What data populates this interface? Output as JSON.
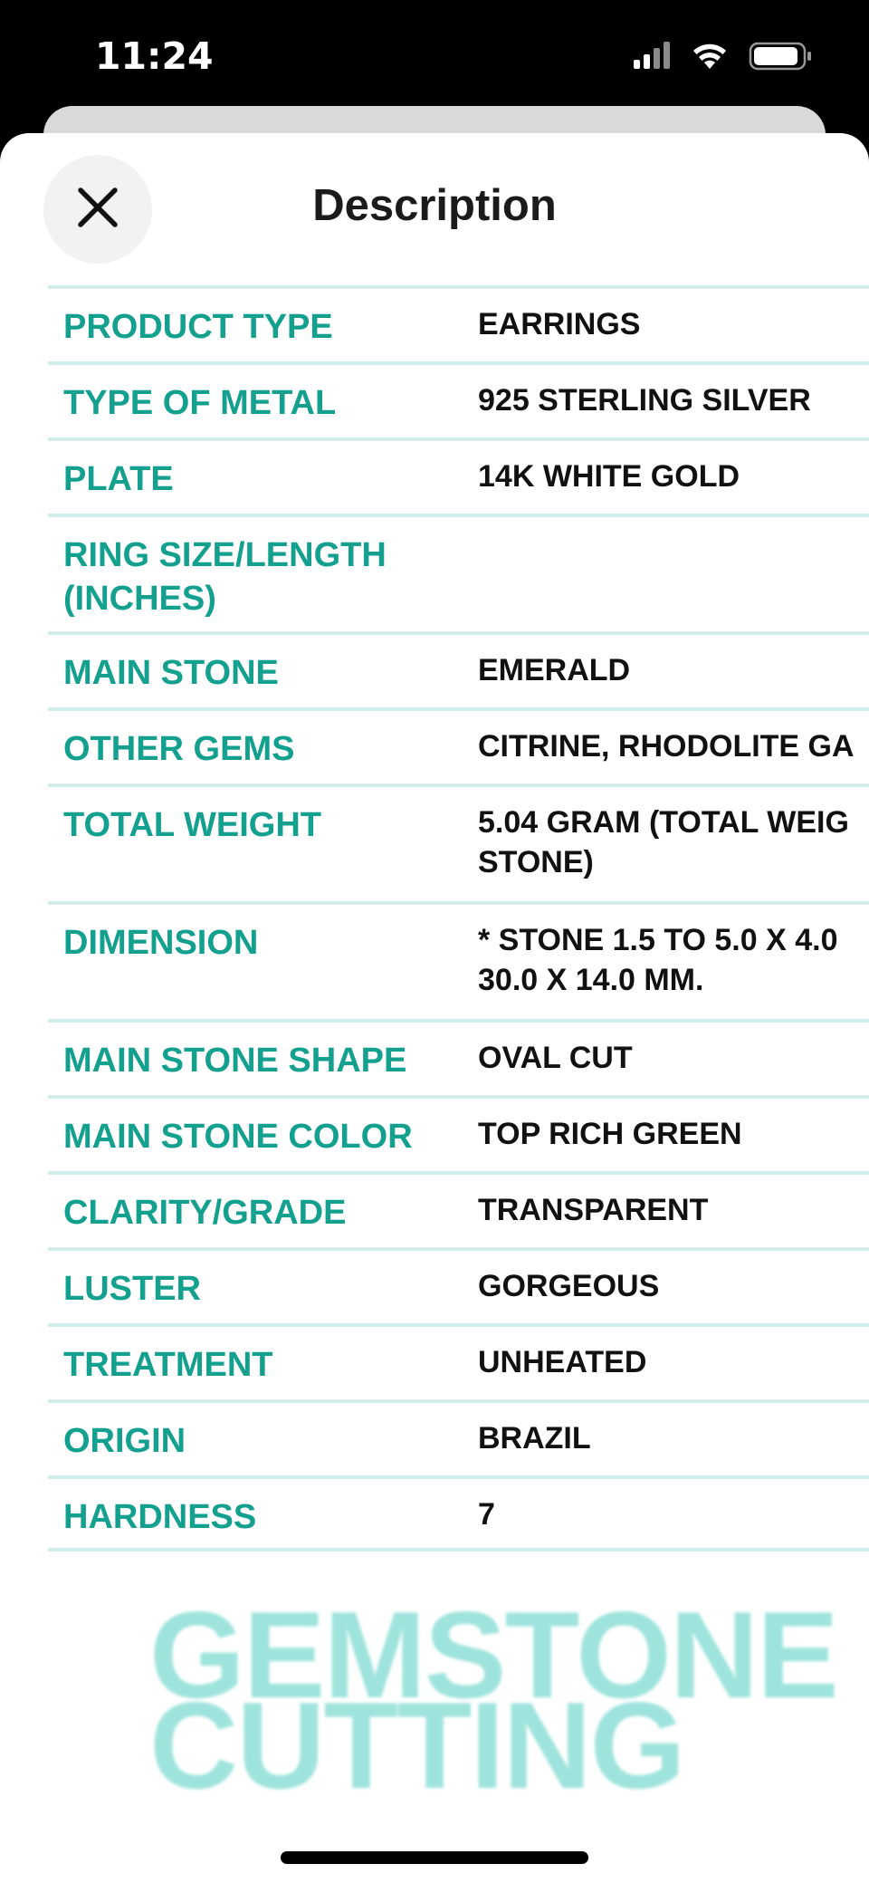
{
  "status_bar": {
    "time": "11:24",
    "icons": [
      "signal-icon",
      "wifi-icon",
      "battery-icon"
    ]
  },
  "sheet": {
    "title": "Description",
    "close_icon": "close-icon"
  },
  "specs": [
    {
      "label": "PRODUCT TYPE",
      "value": [
        "EARRINGS"
      ]
    },
    {
      "label": "TYPE OF METAL",
      "value": [
        "925 STERLING SILVER"
      ]
    },
    {
      "label": "PLATE",
      "value": [
        "14K WHITE GOLD"
      ]
    },
    {
      "label": "RING SIZE/LENGTH (INCHES)",
      "label_lines": [
        "RING SIZE/LENGTH",
        "(INCHES)"
      ],
      "value": []
    },
    {
      "label": "MAIN STONE",
      "value": [
        "EMERALD"
      ]
    },
    {
      "label": "OTHER GEMS",
      "value": [
        "CITRINE, RHODOLITE GA"
      ]
    },
    {
      "label": "TOTAL WEIGHT",
      "value": [
        "5.04 GRAM (TOTAL WEIG",
        "STONE)"
      ]
    },
    {
      "label": "DIMENSION",
      "value": [
        "* STONE 1.5 TO 5.0 X 4.0",
        "30.0 X 14.0 MM."
      ]
    },
    {
      "label": "MAIN STONE SHAPE",
      "value": [
        "OVAL CUT"
      ]
    },
    {
      "label": "MAIN STONE COLOR",
      "value": [
        "TOP RICH GREEN"
      ]
    },
    {
      "label": "CLARITY/GRADE",
      "value": [
        "TRANSPARENT"
      ]
    },
    {
      "label": "LUSTER",
      "value": [
        "GORGEOUS"
      ]
    },
    {
      "label": "TREATMENT",
      "value": [
        "UNHEATED"
      ]
    },
    {
      "label": "ORIGIN",
      "value": [
        "BRAZIL"
      ]
    },
    {
      "label": "HARDNESS",
      "value": [
        "7"
      ]
    }
  ],
  "logo": {
    "lines": [
      "GEMSTONE",
      "CUTTING"
    ]
  },
  "colors": {
    "label": "#14a08e",
    "value": "#111111",
    "divider": "#d2eeeb",
    "logo": "#9fe4dc",
    "close_bg": "#f2f2f2"
  }
}
